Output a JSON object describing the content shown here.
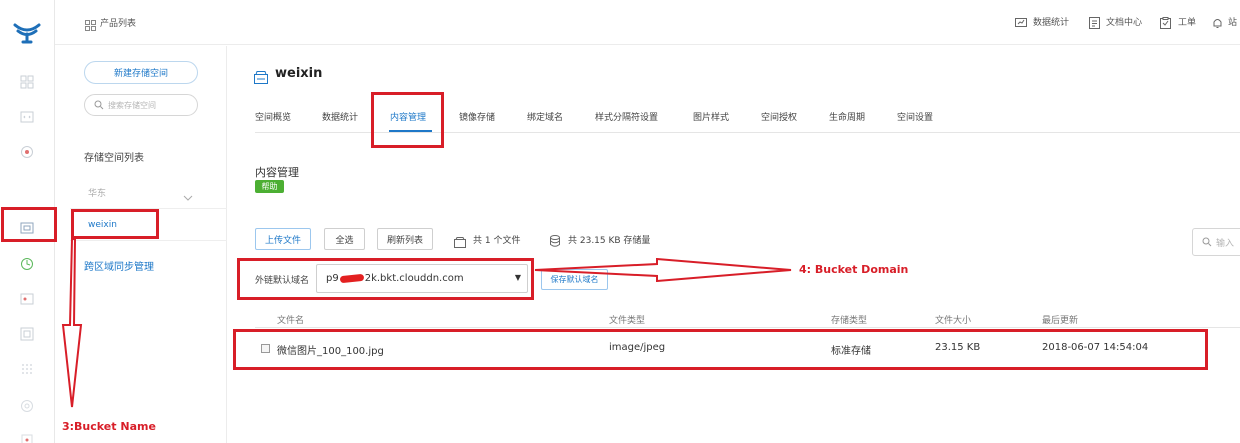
{
  "header": {
    "product_list": "产品列表",
    "data_stats": "数据统计",
    "doc_center": "文档中心",
    "ticket": "工单",
    "site_msg": "站"
  },
  "sidebar": {
    "new_bucket": "新建存储空间",
    "search_placeholder": "搜索存储空间",
    "bucket_list_title": "存储空间列表",
    "region": "华东",
    "bucket_name": "weixin",
    "cross_region": "跨区域同步管理"
  },
  "bucket": {
    "title": "weixin"
  },
  "tabs": [
    "空间概览",
    "数据统计",
    "内容管理",
    "镜像存储",
    "绑定域名",
    "样式分隔符设置",
    "图片样式",
    "空间授权",
    "生命周期",
    "空间设置"
  ],
  "content": {
    "title": "内容管理",
    "help": "帮助",
    "upload": "上传文件",
    "select_all": "全选",
    "refresh": "刷新列表",
    "file_count": "共 1 个文件",
    "storage": "共 23.15 KB 存储量",
    "search_placeholder": "输入",
    "domain_label": "外链默认域名",
    "domain_value_prefix": "p9",
    "domain_value_suffix": "2k.bkt.clouddn.com",
    "save_domain": "保存默认域名"
  },
  "table": {
    "headers": [
      "文件名",
      "文件类型",
      "存储类型",
      "文件大小",
      "最后更新"
    ],
    "rows": [
      [
        "微信图片_100_100.jpg",
        "image/jpeg",
        "标准存储",
        "23.15 KB",
        "2018-06-07 14:54:04"
      ]
    ]
  },
  "annotations": {
    "bucket_domain": "4: Bucket Domain",
    "bucket_name": "3:Bucket Name"
  },
  "colors": {
    "accent": "#1e78c8",
    "annotation_red": "#d81e28",
    "help_green": "#4caf33"
  }
}
